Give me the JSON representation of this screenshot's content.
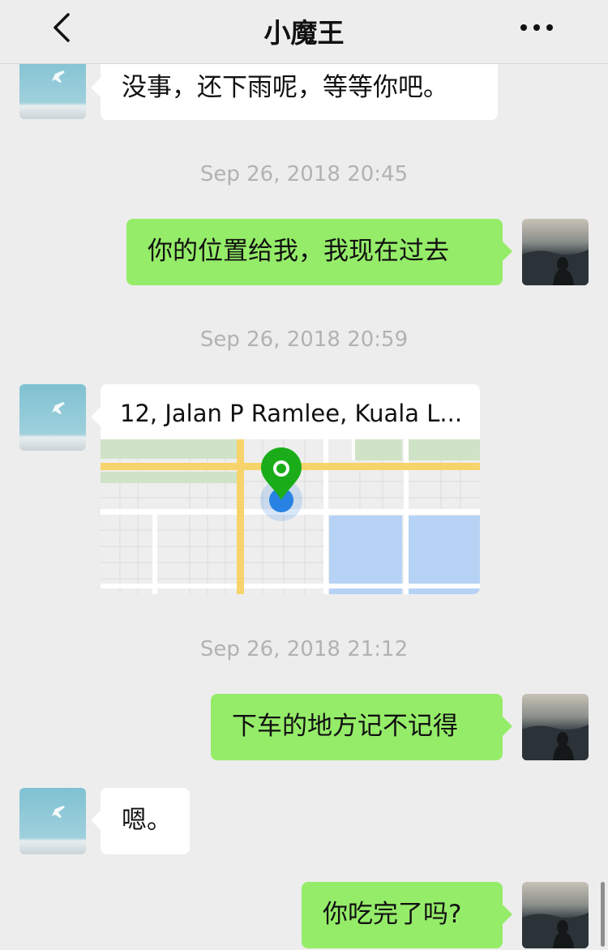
{
  "header": {
    "title": "小魔王",
    "back_icon": "chevron-left-icon",
    "more_icon": "more-dots-icon"
  },
  "messages": [
    {
      "side": "left",
      "text": "没事，还下雨呢，等等你吧。"
    },
    {
      "type": "timestamp",
      "text": "Sep 26, 2018 20:45"
    },
    {
      "side": "right",
      "text": "你的位置给我，我现在过去"
    },
    {
      "type": "timestamp",
      "text": "Sep 26, 2018 20:59"
    },
    {
      "side": "left",
      "type": "location",
      "text": "12, Jalan P Ramlee, Kuala L..."
    },
    {
      "type": "timestamp",
      "text": "Sep 26, 2018 21:12"
    },
    {
      "side": "right",
      "text": "下车的地方记不记得"
    },
    {
      "side": "left",
      "text": "嗯。"
    },
    {
      "side": "right",
      "text": "你吃完了吗?"
    }
  ],
  "colors": {
    "background": "#ededed",
    "bubble_self": "#95ec69",
    "bubble_other": "#ffffff",
    "timestamp": "#b2b2b2",
    "map_pin": "#1aad19",
    "map_dot": "#2782e3"
  }
}
